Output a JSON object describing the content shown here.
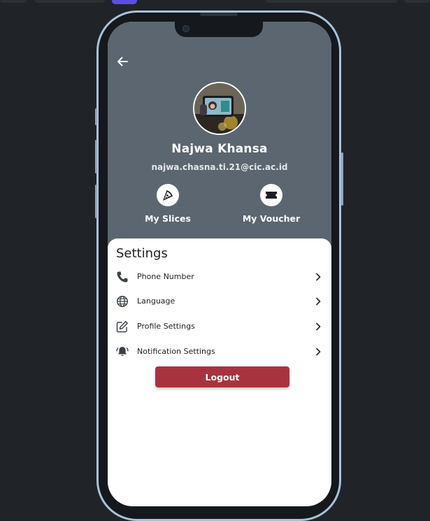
{
  "profile": {
    "name": "Najwa Khansa",
    "email": "najwa.chasna.ti.21@cic.ac.id"
  },
  "quick_actions": [
    {
      "label": "My Slices",
      "icon": "pizza-icon"
    },
    {
      "label": "My Voucher",
      "icon": "ticket-icon"
    }
  ],
  "settings": {
    "title": "Settings",
    "items": [
      {
        "label": "Phone Number",
        "icon": "phone-icon"
      },
      {
        "label": "Language",
        "icon": "globe-icon"
      },
      {
        "label": "Profile Settings",
        "icon": "edit-icon"
      },
      {
        "label": "Notification Settings",
        "icon": "bell-icon"
      }
    ]
  },
  "logout_label": "Logout",
  "colors": {
    "page_background": "#202428",
    "header_background": "#5b6670",
    "logout_button": "#a8333f",
    "phone_frame": "#a9c2d8"
  }
}
